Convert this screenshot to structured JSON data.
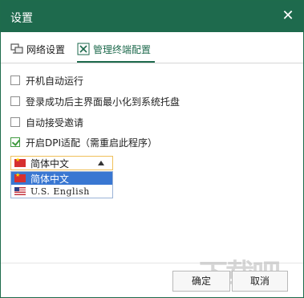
{
  "window": {
    "title": "设置",
    "close_glyph": "✕"
  },
  "tabs": [
    {
      "label": "网络设置",
      "icon": "network-icon",
      "active": false
    },
    {
      "label": "管理终端配置",
      "icon": "tools-icon",
      "active": true
    }
  ],
  "options": [
    {
      "label": "开机自动运行",
      "checked": false
    },
    {
      "label": "登录成功后主界面最小化到系统托盘",
      "checked": false
    },
    {
      "label": "自动接受邀请",
      "checked": false
    },
    {
      "label": "开启DPI适配（需重启此程序）",
      "checked": true
    }
  ],
  "language": {
    "selected": "简体中文",
    "options": [
      {
        "label": "简体中文",
        "flag": "flag-cn-icon",
        "highlighted": true
      },
      {
        "label": "U.S. English",
        "flag": "flag-us-icon",
        "highlighted": false
      }
    ]
  },
  "buttons": {
    "ok": "确定",
    "cancel": "取消"
  },
  "watermark": "下载吧",
  "colors": {
    "accent": "#1e6a4d",
    "check": "#3f9a3f",
    "highlight": "#3977d2",
    "select_border": "#f0c05a"
  }
}
